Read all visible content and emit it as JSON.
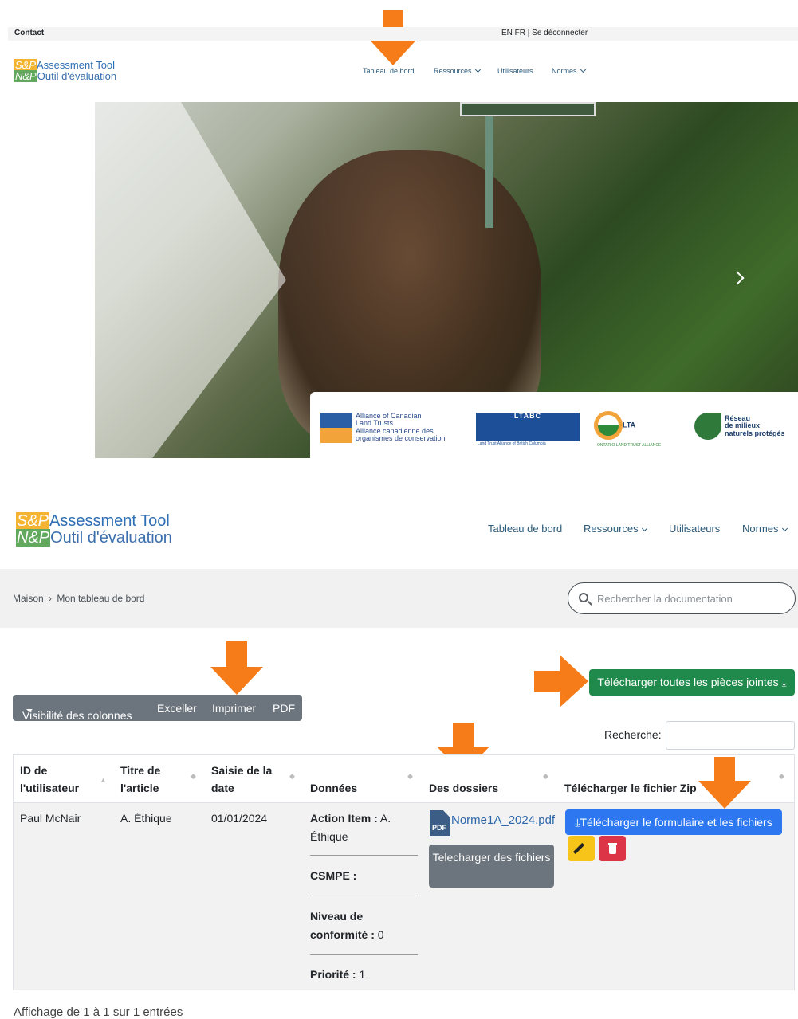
{
  "topbar": {
    "contact": "Contact",
    "lang": "EN FR | Se déconnecter"
  },
  "logo": {
    "line1_tag": "S&P",
    "line1_text": "Assessment Tool",
    "line2_tag": "N&P",
    "line2_text": "Outil d'évaluation"
  },
  "nav": {
    "dashboard": "Tableau de bord",
    "resources": "Ressources",
    "users": "Utilisateurs",
    "standards": "Normes"
  },
  "hero": {
    "partners": {
      "p1_line1": "Alliance of Canadian",
      "p1_line2": "Land Trusts",
      "p1_line3": "Alliance canadienne des",
      "p1_line4": "organismes de conservation",
      "p2": "LTABC",
      "p2_sub": "Land Trust Alliance of British Columbia",
      "p3": "LTA",
      "p3_sub": "ONTARIO LAND TRUST ALLIANCE",
      "p4_line1": "Réseau",
      "p4_line2": "de milieux",
      "p4_line3": "naturels protégés"
    }
  },
  "breadcrumb": {
    "home": "Maison",
    "sep": "›",
    "current": "Mon tableau de bord"
  },
  "search": {
    "placeholder": "Rechercher la documentation"
  },
  "toolbar": {
    "col_visibility": "Visibilité des colonnes",
    "excel": "Exceller",
    "print": "Imprimer",
    "pdf": "PDF"
  },
  "download_all": "Télécharger toutes les pièces jointes",
  "table_search_label": "Recherche:",
  "table": {
    "headers": [
      "ID de l'utilisateur",
      "Titre de l'article",
      "Saisie de la date",
      "Données",
      "Des dossiers",
      "Télécharger le fichier Zip"
    ],
    "row": {
      "user": "Paul McNair",
      "title": "A. Éthique",
      "date": "01/01/2024",
      "data": [
        {
          "label": "Action Item :",
          "value": "A. Éthique"
        },
        {
          "label": "CSMPE :",
          "value": ""
        },
        {
          "label": "Niveau de conformité :",
          "value": "0"
        },
        {
          "label": "Priorité :",
          "value": "1"
        }
      ],
      "file_link": "Norme1A_2024.pdf",
      "file_icon_text": "PDF",
      "download_files": "Telecharger des fichiers",
      "zip_button": "Télécharger le formulaire et les fichiers"
    }
  },
  "footer_info": "Affichage de 1 à 1 sur 1 entrées",
  "colors": {
    "arrow": "#f57c19",
    "green": "#1f8a4c",
    "blue": "#2d78f0",
    "grey": "#6c757d",
    "yellow": "#f7c419",
    "red": "#dc3545"
  }
}
